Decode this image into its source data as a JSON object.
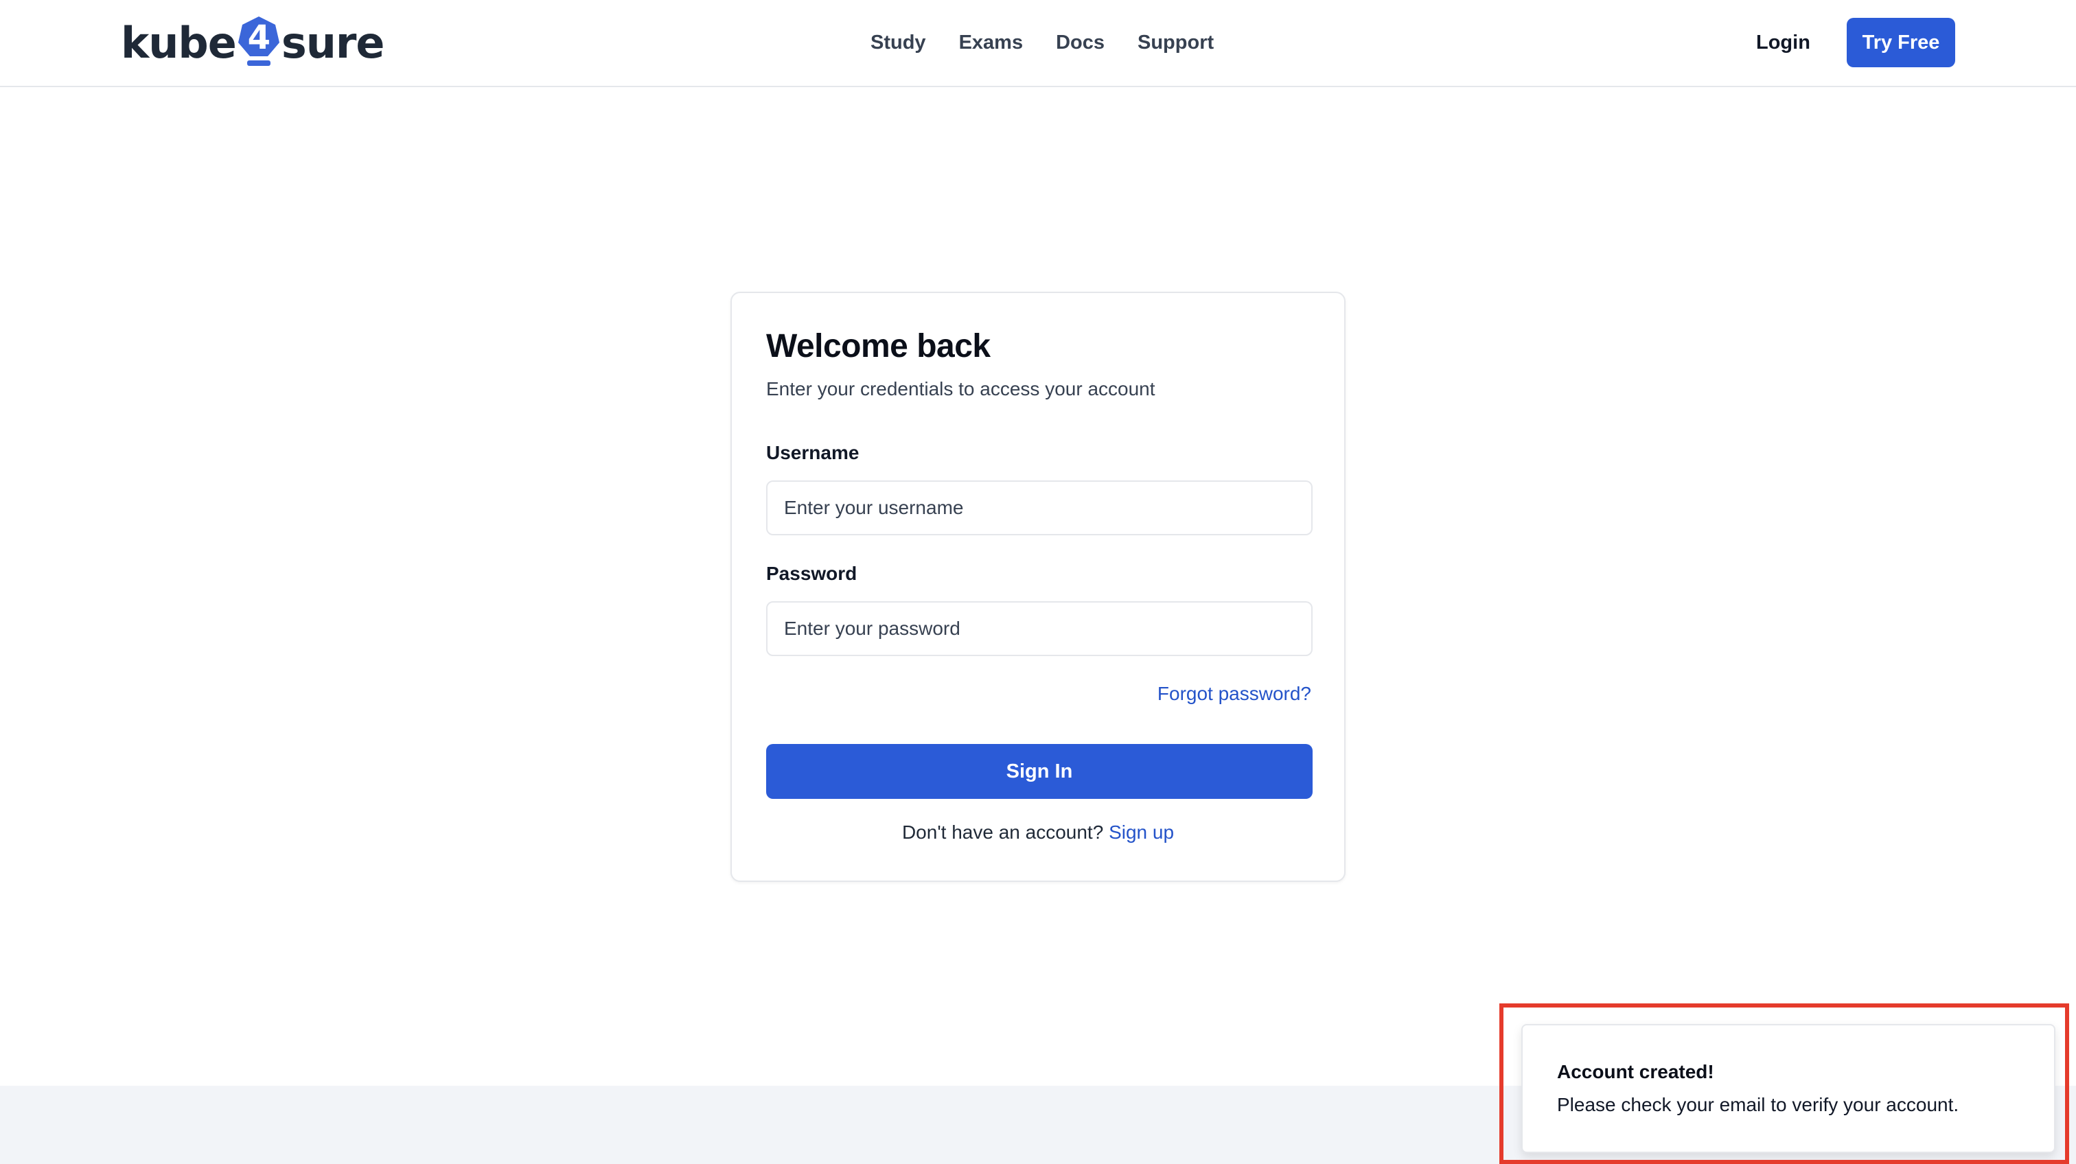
{
  "header": {
    "logo": {
      "prefix": "kube",
      "digit": "4",
      "suffix": "sure"
    },
    "nav": [
      {
        "label": "Study"
      },
      {
        "label": "Exams"
      },
      {
        "label": "Docs"
      },
      {
        "label": "Support"
      }
    ],
    "login_label": "Login",
    "try_free_label": "Try Free"
  },
  "login_form": {
    "title": "Welcome back",
    "subtitle": "Enter your credentials to access your account",
    "username_label": "Username",
    "username_placeholder": "Enter your username",
    "username_value": "",
    "password_label": "Password",
    "password_placeholder": "Enter your password",
    "password_value": "",
    "forgot_password_label": "Forgot password?",
    "sign_in_label": "Sign In",
    "signup_prompt": "Don't have an account?",
    "signup_link_label": "Sign up"
  },
  "toast": {
    "title": "Account created!",
    "message": "Please check your email to verify your account."
  },
  "colors": {
    "primary": "#2b5bd7",
    "link": "#2453c9",
    "highlight": "#e53b2c",
    "footer_bg": "#f2f4f8"
  }
}
